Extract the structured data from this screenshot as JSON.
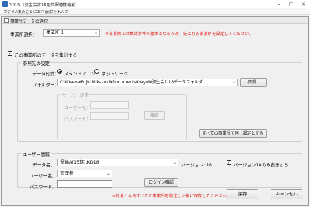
{
  "window": {
    "title": "YOOS（別金会計18用仕訳連携機能）",
    "controls": [
      "minimize-icon",
      "maximize-icon",
      "close-icon"
    ]
  },
  "menu": [
    "ファイル",
    "拠点ごとにおける(保存)",
    "ヘルプ"
  ],
  "dialog": {
    "title": "事業所データの選択",
    "office_select_label": "事業所選択：",
    "office_value": "事業所 1",
    "office_note": "※事業所１は集計条件の基本となるため、先となる事業所を設定してください。",
    "aggregate_checkbox_label": "この事業所のデータを集計する",
    "aggregate_checked": true,
    "ref_group": {
      "caption": "参照先の設定",
      "data_format_label": "データ形式：",
      "radio_standalone": "スタンドアロン",
      "radio_network": "ネットワーク",
      "standalone_selected": true,
      "folder_label": "フォルダー：",
      "folder_value": "C:¥Users¥Fujio Mikazuki¥Documents¥Yayoi¥弥生会計18データフォルダ",
      "browse_button": "参照...",
      "server_group": {
        "caption": "サーバー設定",
        "username_label": "ユーザー名：",
        "password_label": "パスワード：",
        "connect_button": "接続"
      },
      "apply_all_button": "すべての事業所で同じ設定とする"
    },
    "user_group": {
      "caption": "ユーザー情報",
      "data_name_label": "データ名：",
      "data_name_value": "運輸A(15期).KD18",
      "version_text": "バージョン: 18",
      "show_v18_only_label": "バージョン18のみ表示する",
      "show_v18_only_checked": true,
      "username_label": "ユーザー名：",
      "username_value": "管理者",
      "password_label": "パスワード：",
      "password_value": "",
      "login_button": "ログイン確認"
    },
    "footer_note": "※対象となるすべての事業所を設定した後に保存してください。",
    "save_button": "保存",
    "cancel_button": "キャンセル"
  },
  "colors": {
    "warning_text": "#e0201a",
    "window_bg": "#f0f0f0"
  }
}
